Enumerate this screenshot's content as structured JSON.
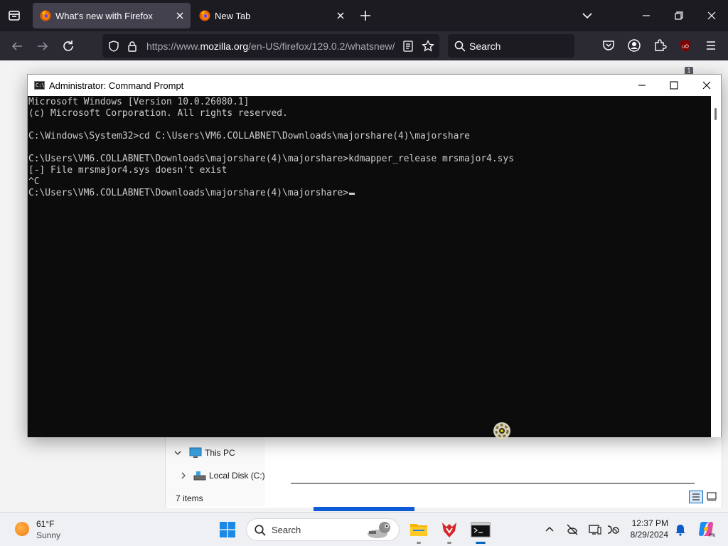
{
  "firefox": {
    "tabs": [
      {
        "title": "What's new with Firefox",
        "active": true
      },
      {
        "title": "New Tab",
        "active": false
      }
    ],
    "url": {
      "prefix": "https://www.",
      "domain": "mozilla.org",
      "path": "/en-US/firefox/129.0.2/whatsnew/"
    },
    "search_placeholder": "Search",
    "extension_badge": "1"
  },
  "cmd": {
    "title": "Administrator: Command Prompt",
    "lines": [
      "Microsoft Windows [Version 10.0.26080.1]",
      "(c) Microsoft Corporation. All rights reserved.",
      "",
      "C:\\Windows\\System32>cd C:\\Users\\VM6.COLLABNET\\Downloads\\majorshare(4)\\majorshare",
      "",
      "C:\\Users\\VM6.COLLABNET\\Downloads\\majorshare(4)\\majorshare>kdmapper_release mrsmajor4.sys",
      "[-] File mrsmajor4.sys doesn't exist",
      "^C",
      "C:\\Users\\VM6.COLLABNET\\Downloads\\majorshare(4)\\majorshare>"
    ]
  },
  "explorer": {
    "tree": [
      {
        "label": "This PC",
        "expanded": true
      },
      {
        "label": "Local Disk (C:)",
        "expanded": false
      }
    ],
    "status": "7 items"
  },
  "taskbar": {
    "weather": {
      "temp": "61°F",
      "condition": "Sunny"
    },
    "search_placeholder": "Search",
    "time": "12:37 PM",
    "date": "8/29/2024"
  },
  "colors": {
    "ff_tabbar": "#1c1b22",
    "ff_toolbar": "#2b2a33",
    "console_bg": "#0c0c0c",
    "console_fg": "#cccccc",
    "accent": "#0067c0"
  }
}
